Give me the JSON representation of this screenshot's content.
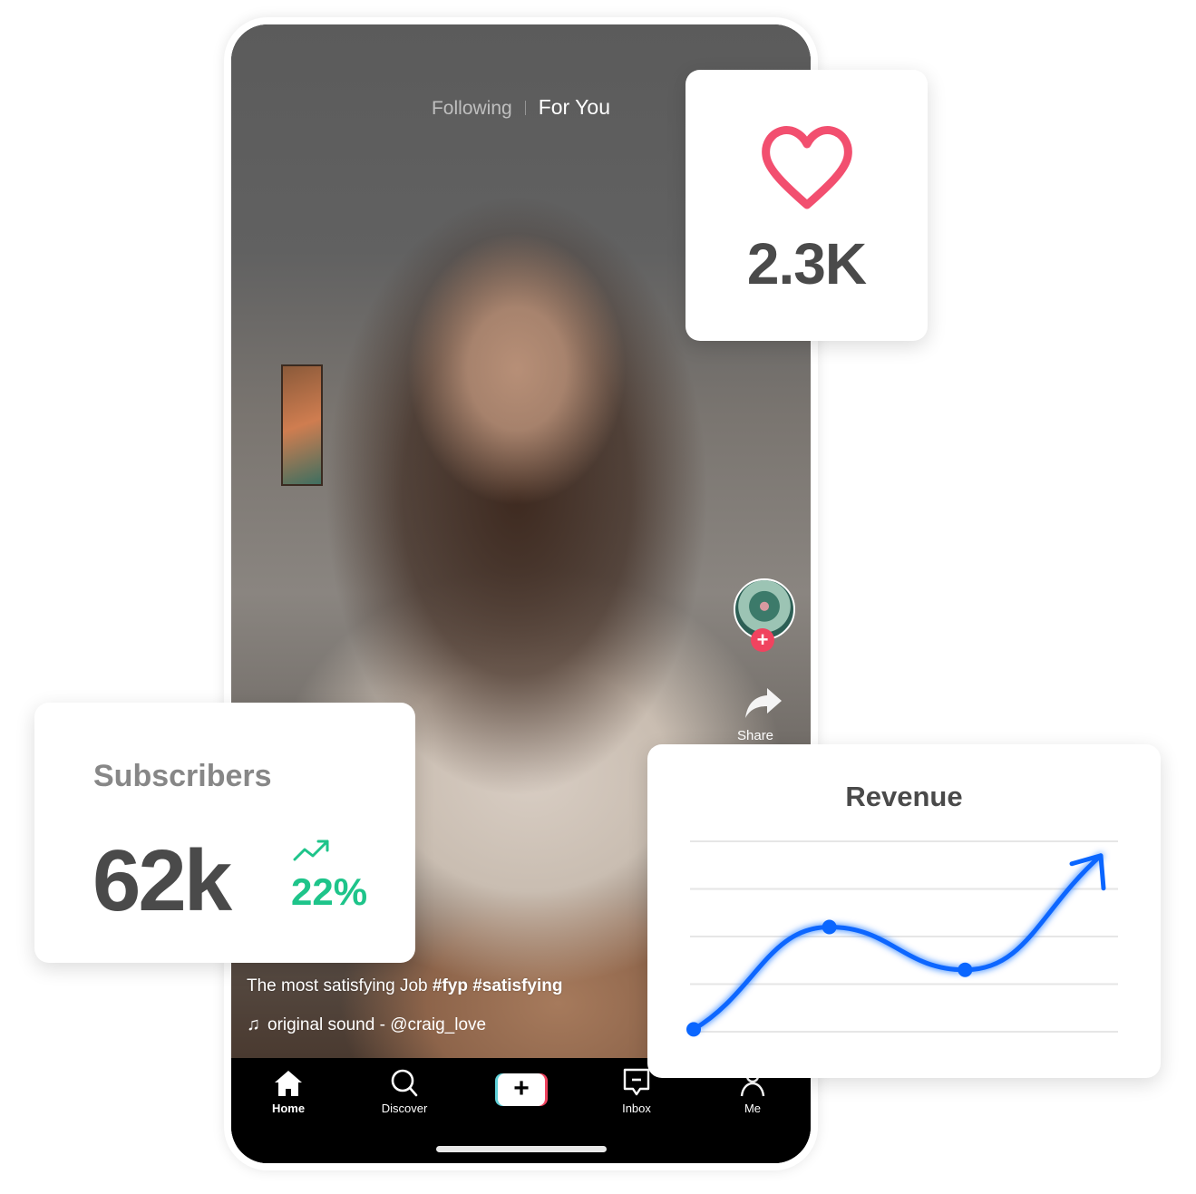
{
  "feed": {
    "tabs": [
      {
        "label": "Following",
        "active": false
      },
      {
        "label": "For You",
        "active": true
      }
    ],
    "caption_text": "The most satisfying Job",
    "caption_tags": "#fyp #satisfying",
    "sound_label": "original sound - @craig_love",
    "share_label": "Share",
    "follow_icon": "plus-icon"
  },
  "navbar": {
    "items": [
      {
        "label": "Home",
        "icon": "home-icon",
        "active": true
      },
      {
        "label": "Discover",
        "icon": "search-icon",
        "active": false
      },
      {
        "label": "",
        "icon": "create-plus-icon",
        "active": false
      },
      {
        "label": "Inbox",
        "icon": "inbox-icon",
        "active": false
      },
      {
        "label": "Me",
        "icon": "profile-icon",
        "active": false
      }
    ]
  },
  "likes_card": {
    "icon": "heart-icon",
    "value": "2.3K",
    "accent": "#f24f6f"
  },
  "subscribers_card": {
    "title": "Subscribers",
    "value": "62k",
    "change": "22%",
    "change_icon": "trending-up-icon",
    "change_color": "#1ec48a"
  },
  "revenue_card": {
    "title": "Revenue"
  },
  "chart_data": {
    "type": "line",
    "title": "Revenue",
    "xlabel": "",
    "ylabel": "",
    "grid": true,
    "grid_lines": 5,
    "ylim": [
      0,
      4
    ],
    "series": [
      {
        "name": "Revenue",
        "color": "#0a66ff",
        "x": [
          0,
          1,
          2,
          3
        ],
        "values": [
          0.05,
          2.2,
          1.3,
          3.7
        ],
        "markers": [
          true,
          true,
          true,
          false
        ],
        "end_arrow": true
      }
    ]
  }
}
